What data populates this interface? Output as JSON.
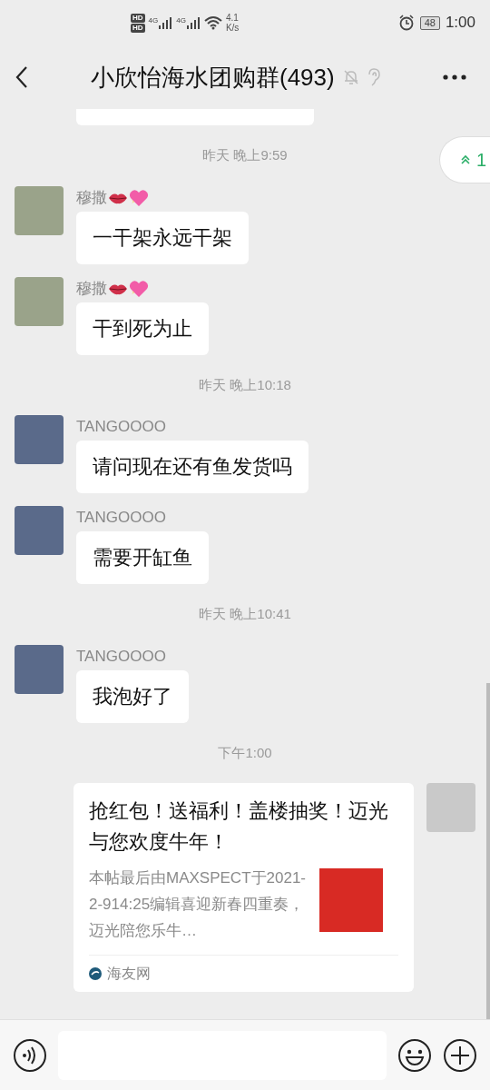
{
  "status_bar": {
    "sim_labels": [
      "HD",
      "HD"
    ],
    "network": [
      "4G",
      "4G"
    ],
    "speed": "4.1",
    "speed_unit": "K/s",
    "battery": "48",
    "time": "1:00"
  },
  "header": {
    "title": "小欣怡海水团购群(493)",
    "muted": true
  },
  "unread_badge": {
    "count": "1"
  },
  "messages": [
    {
      "kind": "cut"
    },
    {
      "kind": "time",
      "text": "昨天 晚上9:59"
    },
    {
      "kind": "text",
      "sender": "穆撒",
      "emoji": true,
      "color": "#9aa38a",
      "text": "一干架永远干架"
    },
    {
      "kind": "text",
      "sender": "穆撒",
      "emoji": true,
      "color": "#9aa38a",
      "text": "干到死为止"
    },
    {
      "kind": "time",
      "text": "昨天 晚上10:18"
    },
    {
      "kind": "text",
      "sender": "TANGOOOO",
      "emoji": false,
      "color": "#5a6a8a",
      "text": "请问现在还有鱼发货吗"
    },
    {
      "kind": "text",
      "sender": "TANGOOOO",
      "emoji": false,
      "color": "#5a6a8a",
      "text": "需要开缸鱼"
    },
    {
      "kind": "time",
      "text": "昨天 晚上10:41"
    },
    {
      "kind": "text",
      "sender": "TANGOOOO",
      "emoji": false,
      "color": "#5a6a8a",
      "text": "我泡好了"
    },
    {
      "kind": "time",
      "text": "下午1:00"
    },
    {
      "kind": "link",
      "title": "抢红包！送福利！盖楼抽奖！迈光与您欢度牛年！",
      "description": "本帖最后由MAXSPECT于2021-2-914:25编辑喜迎新春四重奏，迈光陪您乐牛…",
      "source": "海友网"
    }
  ]
}
